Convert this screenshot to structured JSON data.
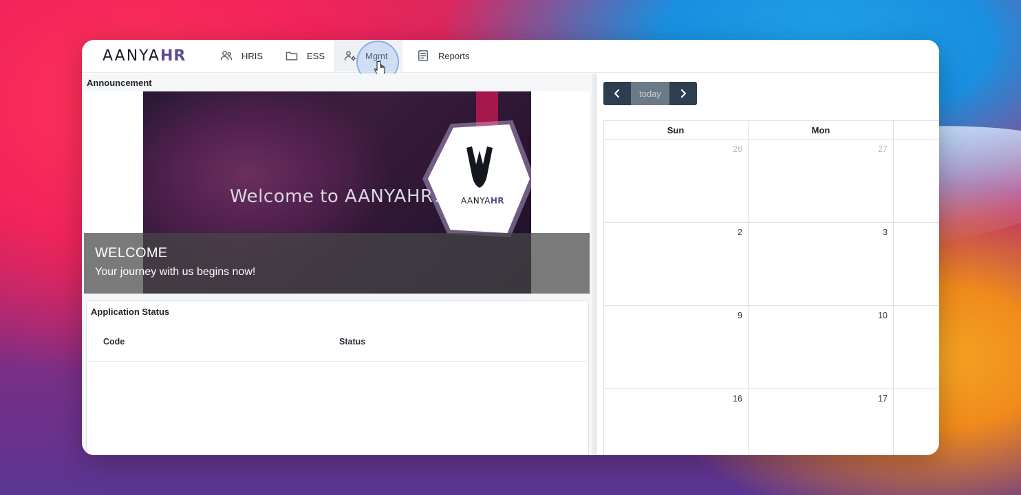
{
  "nav": {
    "logo_main": "AANYA",
    "logo_hr": "HR",
    "items": [
      {
        "label": "HRIS",
        "icon": "users-icon"
      },
      {
        "label": "ESS",
        "icon": "folder-icon"
      },
      {
        "label": "Mgmt",
        "icon": "user-settings-icon"
      },
      {
        "label": "Reports",
        "icon": "document-icon"
      }
    ]
  },
  "announcement": {
    "title": "Announcement",
    "banner_headline": "Welcome to AANYAHR!",
    "banner_logo_main": "AANYA",
    "banner_logo_hr": "HR",
    "caption_title": "WELCOME",
    "caption_text": "Your journey with us begins now!"
  },
  "application_status": {
    "title": "Application Status",
    "columns": [
      "Code",
      "Status"
    ]
  },
  "calendar": {
    "today_label": "today",
    "day_names": [
      "Sun",
      "Mon"
    ],
    "weeks": [
      [
        {
          "day": "26",
          "muted": true
        },
        {
          "day": "27",
          "muted": true
        }
      ],
      [
        {
          "day": "2",
          "muted": false
        },
        {
          "day": "3",
          "muted": false
        }
      ],
      [
        {
          "day": "9",
          "muted": false
        },
        {
          "day": "10",
          "muted": false
        }
      ],
      [
        {
          "day": "16",
          "muted": false
        },
        {
          "day": "17",
          "muted": false
        }
      ]
    ]
  },
  "colors": {
    "nav_accent": "#5c4a8c",
    "calendar_button": "#2c3e50",
    "calendar_today_button": "#6c7a88"
  }
}
